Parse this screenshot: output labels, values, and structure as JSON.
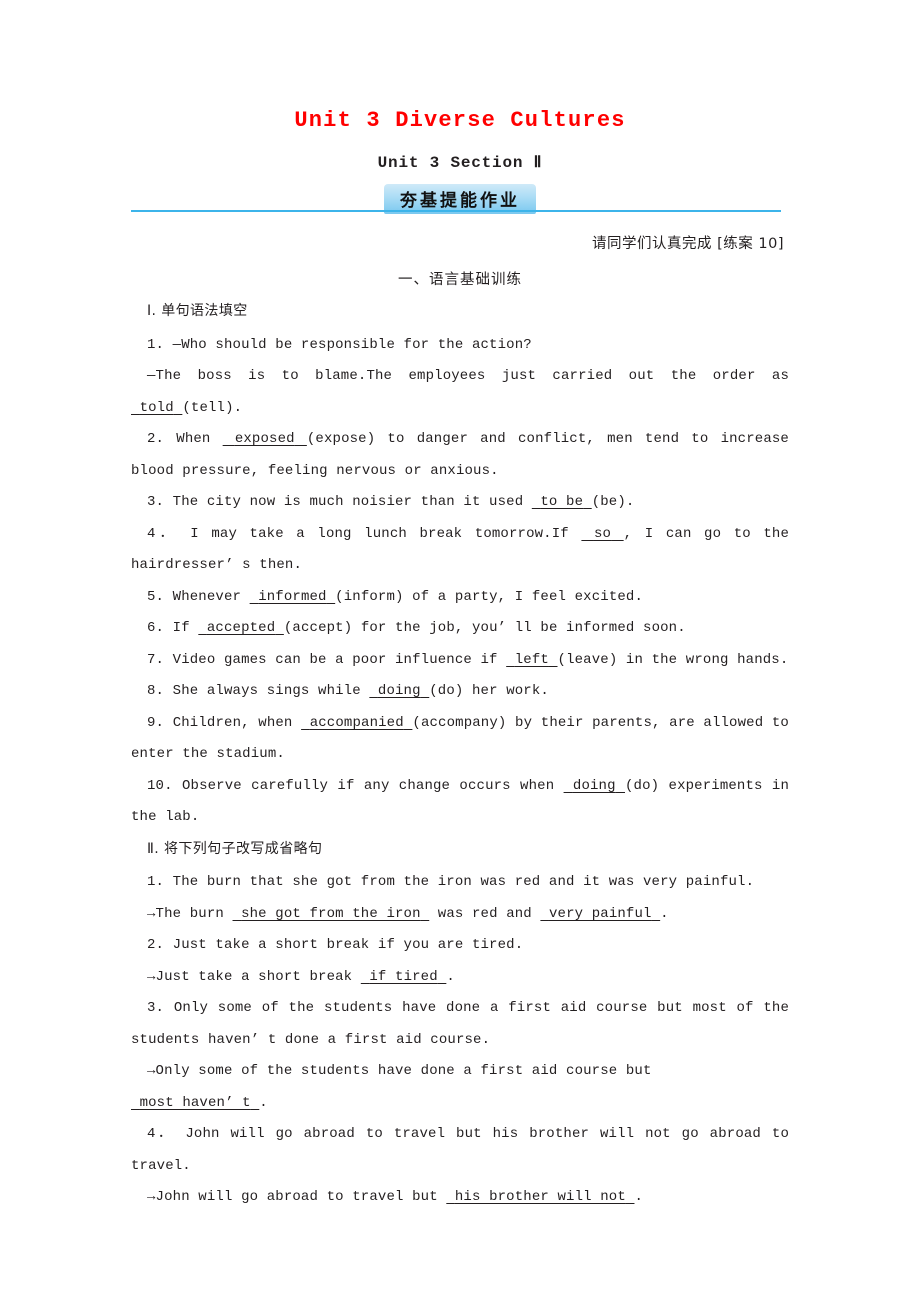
{
  "header": {
    "title": "Unit 3 Diverse Cultures",
    "subtitle": "Unit 3  Section Ⅱ",
    "badge": "夯基提能作业",
    "assignment_note": "请同学们认真完成 [练案 10]",
    "part_heading": "一、语言基础训练",
    "title_color": "#ff0000",
    "rule_color": "#3cb4ea",
    "badge_color": "#aadcf5"
  },
  "sections": [
    {
      "heading": "Ⅰ. 单句语法填空",
      "items": [
        {
          "lines": [
            {
              "indent": true,
              "parts": [
                {
                  "t": "1. —Who should be responsible for the action?"
                }
              ]
            },
            {
              "indent": true,
              "justify": true,
              "parts": [
                {
                  "t": "—The boss is to blame.The employees just carried out the order as "
                },
                {
                  "blank": "told"
                },
                {
                  "t": "(tell)."
                }
              ]
            }
          ]
        },
        {
          "lines": [
            {
              "indent": true,
              "justify": true,
              "parts": [
                {
                  "t": "2. When "
                },
                {
                  "blank": "exposed"
                },
                {
                  "t": "(expose) to danger and conflict, men tend to increase blood pressure, feeling nervous or anxious."
                }
              ]
            }
          ]
        },
        {
          "lines": [
            {
              "indent": true,
              "parts": [
                {
                  "t": "3. The city now is much noisier than it used "
                },
                {
                  "blank": "to be"
                },
                {
                  "t": "(be)."
                }
              ]
            }
          ]
        },
        {
          "lines": [
            {
              "indent": true,
              "justify": true,
              "parts": [
                {
                  "t": "4． I may take a long lunch break tomorrow.If "
                },
                {
                  "blank": "so"
                },
                {
                  "t": ", I can go to the hairdresser’ s then."
                }
              ]
            }
          ]
        },
        {
          "lines": [
            {
              "indent": true,
              "parts": [
                {
                  "t": "5. Whenever "
                },
                {
                  "blank": "informed"
                },
                {
                  "t": "(inform) of a party, I feel excited."
                }
              ]
            }
          ]
        },
        {
          "lines": [
            {
              "indent": true,
              "parts": [
                {
                  "t": "6. If "
                },
                {
                  "blank": "accepted"
                },
                {
                  "t": "(accept) for the job, you’ ll be informed soon."
                }
              ]
            }
          ]
        },
        {
          "lines": [
            {
              "indent": true,
              "parts": [
                {
                  "t": "7. Video games can be a poor influence if "
                },
                {
                  "blank": "left"
                },
                {
                  "t": "(leave) in the wrong hands."
                }
              ]
            }
          ]
        },
        {
          "lines": [
            {
              "indent": true,
              "parts": [
                {
                  "t": "8. She always sings while "
                },
                {
                  "blank": "doing"
                },
                {
                  "t": "(do) her work."
                }
              ]
            }
          ]
        },
        {
          "lines": [
            {
              "indent": true,
              "justify": true,
              "parts": [
                {
                  "t": "9. Children, when "
                },
                {
                  "blank": "accompanied"
                },
                {
                  "t": "(accompany) by their parents, are allowed to enter the stadium."
                }
              ]
            }
          ]
        },
        {
          "lines": [
            {
              "indent": true,
              "justify": true,
              "parts": [
                {
                  "t": "10. Observe carefully if any change occurs when "
                },
                {
                  "blank": "doing"
                },
                {
                  "t": "(do) experiments in the lab."
                }
              ]
            }
          ]
        }
      ]
    },
    {
      "heading": "Ⅱ. 将下列句子改写成省略句",
      "items": [
        {
          "lines": [
            {
              "indent": true,
              "parts": [
                {
                  "t": "1. The burn that she got from the iron was red and it was very painful."
                }
              ]
            },
            {
              "indent": true,
              "parts": [
                {
                  "t": "→The burn "
                },
                {
                  "blank": "she got from the iron"
                },
                {
                  "t": " was red and "
                },
                {
                  "blank": "very painful"
                },
                {
                  "t": "."
                }
              ]
            }
          ]
        },
        {
          "lines": [
            {
              "indent": true,
              "parts": [
                {
                  "t": "2. Just take a short break if you are tired."
                }
              ]
            },
            {
              "indent": true,
              "parts": [
                {
                  "t": "→Just take a short break "
                },
                {
                  "blank": "if tired"
                },
                {
                  "t": "."
                }
              ]
            }
          ]
        },
        {
          "lines": [
            {
              "indent": true,
              "justify": true,
              "parts": [
                {
                  "t": "3. Only some of the students have done a first aid course but most of the students haven’ t done a first aid course."
                }
              ]
            },
            {
              "indent": true,
              "parts": [
                {
                  "t": "→Only some of the students have done a first aid course but "
                },
                {
                  "blank": "most haven’ t"
                },
                {
                  "t": "."
                }
              ]
            }
          ]
        },
        {
          "lines": [
            {
              "indent": true,
              "justify": true,
              "parts": [
                {
                  "t": "4． John will go abroad to travel but his brother will not go abroad to travel."
                }
              ]
            },
            {
              "indent": true,
              "parts": [
                {
                  "t": "→John will go abroad to travel but "
                },
                {
                  "blank": "his brother will not"
                },
                {
                  "t": "."
                }
              ]
            }
          ]
        }
      ]
    }
  ]
}
